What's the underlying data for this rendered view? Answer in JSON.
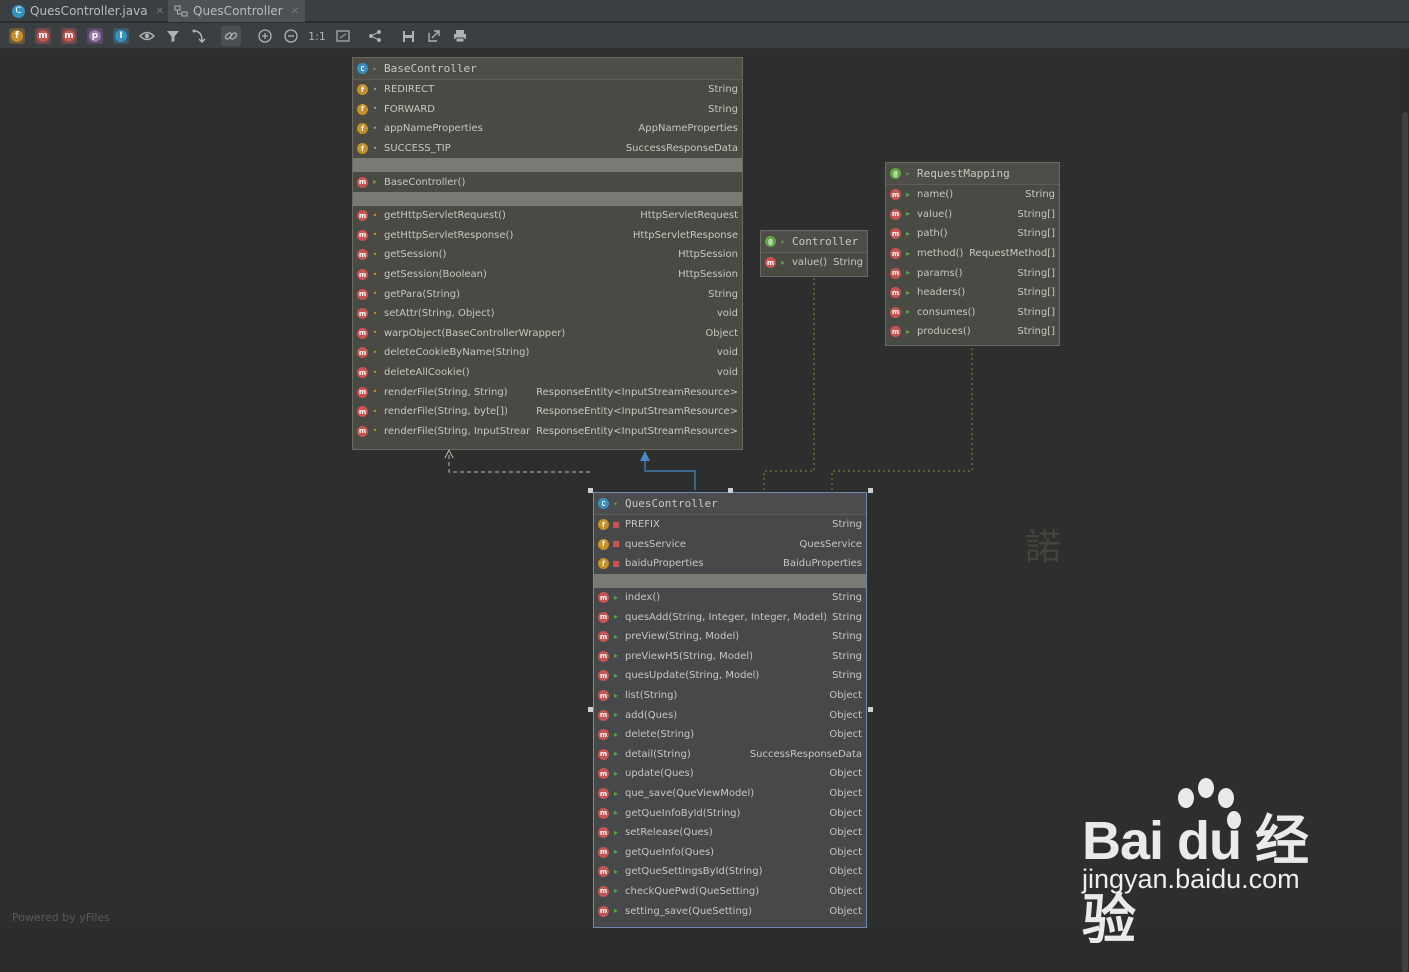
{
  "tabs": [
    {
      "icon": "class-c-icon",
      "label": "QuesController.java",
      "active": false
    },
    {
      "icon": "diagram-icon",
      "label": "QuesController",
      "active": true
    }
  ],
  "toolbar": {
    "items": [
      "fields-filter-icon",
      "constructors-filter-icon",
      "methods-filter-icon",
      "properties-filter-icon",
      "inner-classes-filter-icon",
      "visibility-eye-icon",
      "filter-funnel-icon",
      "dependencies-icon",
      "link-icon",
      "zoom-in-icon",
      "zoom-out-icon",
      "actual-size-icon",
      "fit-content-icon",
      "layout-icon",
      "save-icon",
      "export-icon",
      "print-icon"
    ],
    "actual_size_label": "1:1"
  },
  "nodes": {
    "base": {
      "title": "BaseController",
      "fields": [
        {
          "name": "REDIRECT",
          "type": "String"
        },
        {
          "name": "FORWARD",
          "type": "String"
        },
        {
          "name": "appNameProperties",
          "type": "AppNameProperties"
        },
        {
          "name": "SUCCESS_TIP",
          "type": "SuccessResponseData"
        }
      ],
      "constructors": [
        {
          "name": "BaseController()",
          "type": ""
        }
      ],
      "methods": [
        {
          "name": "getHttpServletRequest()",
          "type": "HttpServletRequest"
        },
        {
          "name": "getHttpServletResponse()",
          "type": "HttpServletResponse"
        },
        {
          "name": "getSession()",
          "type": "HttpSession"
        },
        {
          "name": "getSession(Boolean)",
          "type": "HttpSession"
        },
        {
          "name": "getPara(String)",
          "type": "String"
        },
        {
          "name": "setAttr(String, Object)",
          "type": "void"
        },
        {
          "name": "warpObject(BaseControllerWrapper)",
          "type": "Object"
        },
        {
          "name": "deleteCookieByName(String)",
          "type": "void"
        },
        {
          "name": "deleteAllCookie()",
          "type": "void"
        },
        {
          "name": "renderFile(String, String)",
          "type": "ResponseEntity<InputStreamResource>"
        },
        {
          "name": "renderFile(String, byte[])",
          "type": "ResponseEntity<InputStreamResource>"
        },
        {
          "name": "renderFile(String, InputStream)",
          "type": "ResponseEntity<InputStreamResource>"
        }
      ]
    },
    "controller": {
      "title": "Controller",
      "methods": [
        {
          "name": "value()",
          "type": "String"
        }
      ]
    },
    "requestMapping": {
      "title": "RequestMapping",
      "methods": [
        {
          "name": "name()",
          "type": "String"
        },
        {
          "name": "value()",
          "type": "String[]"
        },
        {
          "name": "path()",
          "type": "String[]"
        },
        {
          "name": "method()",
          "type": "RequestMethod[]"
        },
        {
          "name": "params()",
          "type": "String[]"
        },
        {
          "name": "headers()",
          "type": "String[]"
        },
        {
          "name": "consumes()",
          "type": "String[]"
        },
        {
          "name": "produces()",
          "type": "String[]"
        }
      ]
    },
    "ques": {
      "title": "QuesController",
      "fields": [
        {
          "name": "PREFIX",
          "type": "String"
        },
        {
          "name": "quesService",
          "type": "QuesService"
        },
        {
          "name": "baiduProperties",
          "type": "BaiduProperties"
        }
      ],
      "methods": [
        {
          "name": "index()",
          "type": "String"
        },
        {
          "name": "quesAdd(String, Integer, Integer, Model)",
          "type": "String"
        },
        {
          "name": "preView(String, Model)",
          "type": "String"
        },
        {
          "name": "preViewH5(String, Model)",
          "type": "String"
        },
        {
          "name": "quesUpdate(String, Model)",
          "type": "String"
        },
        {
          "name": "list(String)",
          "type": "Object"
        },
        {
          "name": "add(Ques)",
          "type": "Object"
        },
        {
          "name": "delete(String)",
          "type": "Object"
        },
        {
          "name": "detail(String)",
          "type": "SuccessResponseData"
        },
        {
          "name": "update(Ques)",
          "type": "Object"
        },
        {
          "name": "que_save(QueViewModel)",
          "type": "Object"
        },
        {
          "name": "getQueInfoById(String)",
          "type": "Object"
        },
        {
          "name": "setRelease(Ques)",
          "type": "Object"
        },
        {
          "name": "getQueInfo(Ques)",
          "type": "Object"
        },
        {
          "name": "getQueSettingsById(String)",
          "type": "Object"
        },
        {
          "name": "checkQuePwd(QueSetting)",
          "type": "Object"
        },
        {
          "name": "setting_save(QueSetting)",
          "type": "Object"
        }
      ]
    }
  },
  "footer": {
    "powered": "Powered by yFiles"
  },
  "watermark": {
    "logo": "Bai du 经验",
    "url": "jingyan.baidu.com"
  }
}
